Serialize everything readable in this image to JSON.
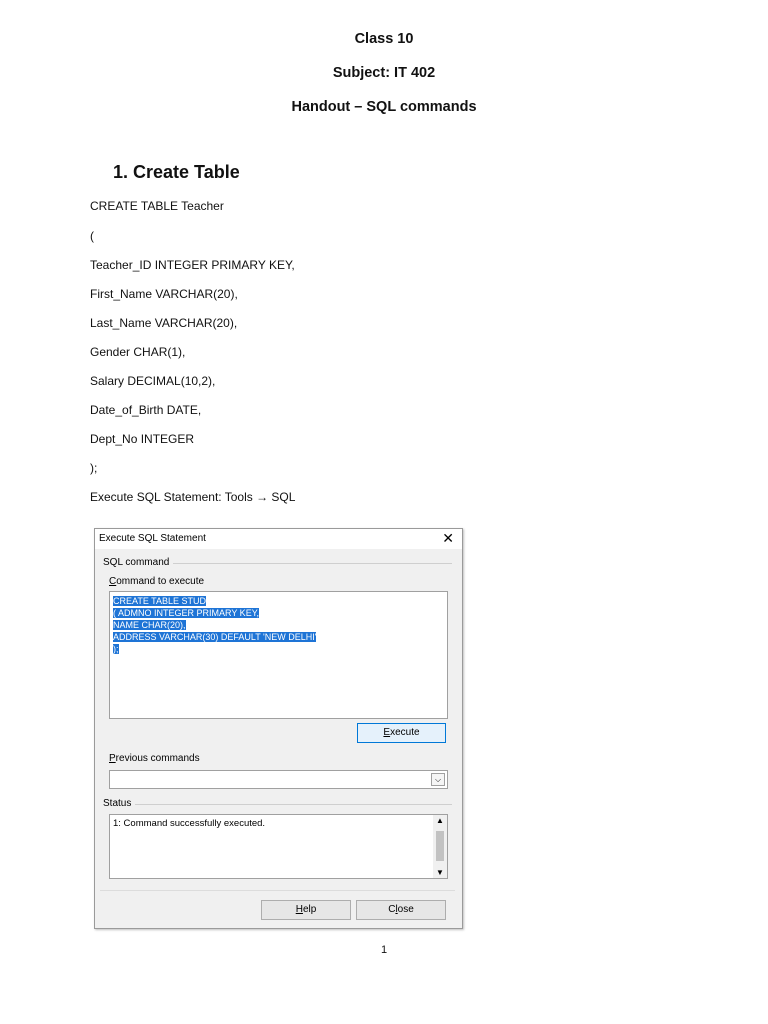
{
  "header": {
    "class": "Class 10",
    "subject": "Subject: IT 402",
    "handout": "Handout – SQL commands"
  },
  "section": {
    "title": "1.  Create Table"
  },
  "code_lines": [
    "CREATE TABLE Teacher",
    "(",
    "Teacher_ID INTEGER PRIMARY KEY,",
    "First_Name VARCHAR(20),",
    "Last_Name VARCHAR(20),",
    "Gender CHAR(1),",
    "Salary DECIMAL(10,2),",
    "Date_of_Birth DATE,",
    "Dept_No INTEGER",
    ");",
    "Execute SQL Statement: Tools → SQL"
  ],
  "dialog": {
    "title": "Execute SQL Statement",
    "close_glyph": "✕",
    "group_sql": "SQL command",
    "command_label_accel": "C",
    "command_label_rest": "ommand to execute",
    "sql_lines": [
      "CREATE TABLE STUD",
      "( ADMNO INTEGER PRIMARY KEY,",
      "NAME CHAR(20),",
      "ADDRESS VARCHAR(30) DEFAULT  'NEW DELHI'",
      ");"
    ],
    "execute_accel": "E",
    "execute_rest": "xecute",
    "previous_accel": "P",
    "previous_rest": "revious commands",
    "previous_value": "",
    "group_status": "Status",
    "status_text": "1: Command successfully executed.",
    "help_accel": "H",
    "help_rest": "elp",
    "close_pre": "C",
    "close_accel": "l",
    "close_rest": "ose"
  },
  "page_number": "1"
}
